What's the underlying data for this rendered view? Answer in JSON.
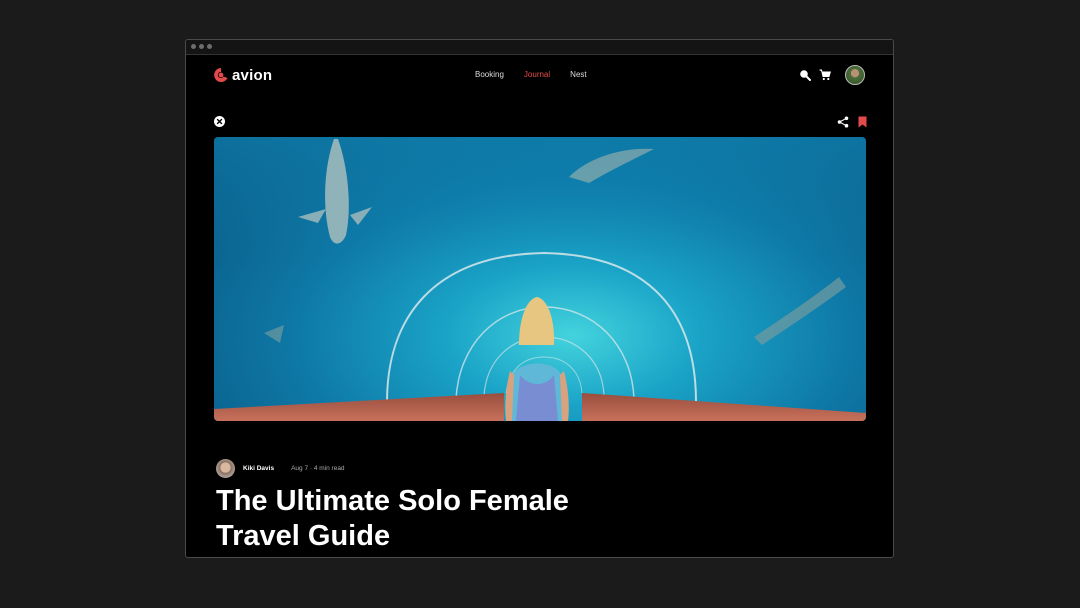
{
  "window": {
    "controls": [
      "close",
      "minimize",
      "maximize"
    ]
  },
  "brand": {
    "name": "avion",
    "accent_color": "#e34b4b"
  },
  "nav": {
    "items": [
      {
        "label": "Booking",
        "active": false
      },
      {
        "label": "Journal",
        "active": true
      },
      {
        "label": "Nest",
        "active": false
      }
    ]
  },
  "header_actions": {
    "icons": [
      "search-icon",
      "cart-icon",
      "user-avatar"
    ]
  },
  "article_toolbar": {
    "icons": [
      "close-icon",
      "share-icon",
      "bookmark-icon"
    ]
  },
  "hero": {
    "image": "woman walking through underwater aquarium tunnel with fish"
  },
  "article": {
    "author": "Kiki Davis",
    "date": "Aug 7",
    "read_time": "4 min read",
    "meta": "Aug 7 · 4 min read",
    "title_line1": "The Ultimate Solo Female",
    "title_line2": "Travel Guide"
  }
}
